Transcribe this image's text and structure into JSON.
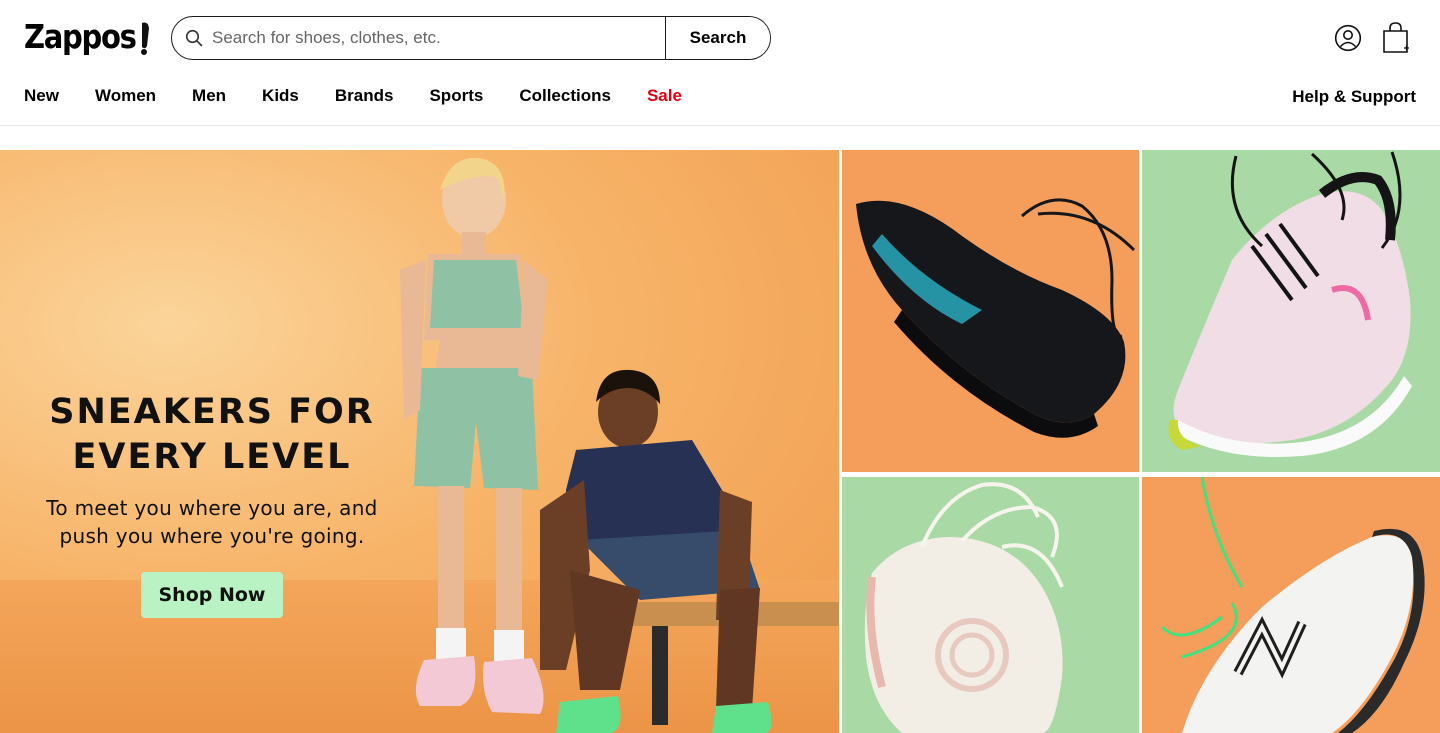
{
  "header": {
    "logo": "Zappos",
    "search": {
      "placeholder": "Search for shoes, clothes, etc.",
      "value": "",
      "button_label": "Search"
    },
    "icons": {
      "account": "account-icon",
      "cart": "shopping-bag-icon"
    }
  },
  "nav": {
    "items": [
      {
        "label": "New"
      },
      {
        "label": "Women"
      },
      {
        "label": "Men"
      },
      {
        "label": "Kids"
      },
      {
        "label": "Brands"
      },
      {
        "label": "Sports"
      },
      {
        "label": "Collections"
      },
      {
        "label": "Sale"
      }
    ],
    "help_label": "Help & Support",
    "sale_color": "#e3000f"
  },
  "hero": {
    "headline": "SNEAKERS FOR EVERY LEVEL",
    "subtext": "To meet you where you are, and push you where you're going.",
    "cta_label": "Shop Now",
    "cta_color": "#b9f2c3",
    "background_color": "#f7b469"
  },
  "tiles": [
    {
      "background_color": "#f59d5b",
      "shoe": "black-running-shoe"
    },
    {
      "background_color": "#a9d9a4",
      "shoe": "pink-running-shoe"
    },
    {
      "background_color": "#a9d9a4",
      "shoe": "white-running-shoe"
    },
    {
      "background_color": "#f59d5b",
      "shoe": "white-black-running-shoe"
    }
  ]
}
